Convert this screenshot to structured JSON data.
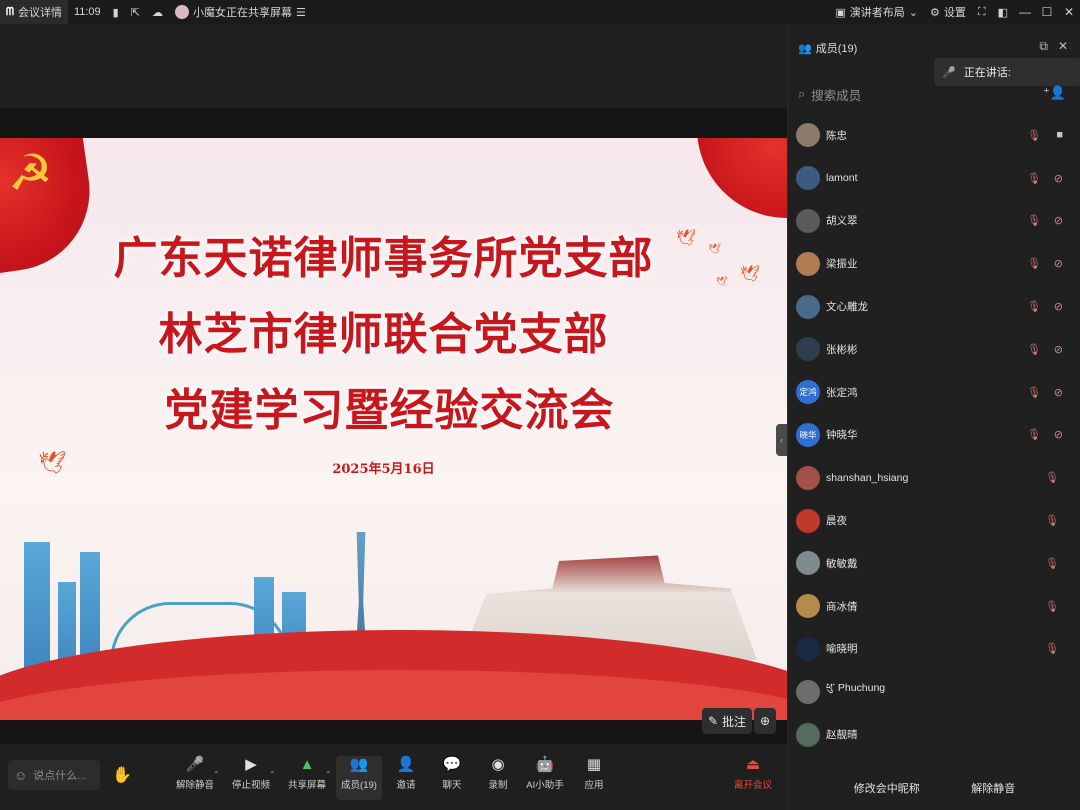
{
  "topbar": {
    "meeting_details": "会议详情",
    "time": "11:09",
    "sharing_notice": "小魔女正在共享屏幕",
    "presenter_layout": "演讲者布局",
    "settings": "设置"
  },
  "slide": {
    "title_line1": "广东天诺律师事务所党支部",
    "title_line2": "林芝市律师联合党支部",
    "title_line3": "党建学习暨经验交流会",
    "date": "2025年5月16日"
  },
  "stage_tools": {
    "annotate": "批注"
  },
  "toolbar": {
    "chat_placeholder": "说点什么...",
    "unmute": "解除静音",
    "stop_video": "停止视频",
    "share_screen": "共享屏幕",
    "members": "成员(19)",
    "invite": "邀请",
    "chat": "聊天",
    "record": "录制",
    "ai_assistant": "AI小助手",
    "apps": "应用",
    "leave": "离开会议"
  },
  "panel": {
    "title": "成员(19)",
    "speaking_label": "正在讲话:",
    "search_placeholder": "搜索成员",
    "footer_rename": "修改会中昵称",
    "footer_unmute": "解除静音",
    "members": [
      {
        "name": "陈忠",
        "avatar_text": "",
        "mic_muted": true,
        "cam": true,
        "cam_off": false
      },
      {
        "name": "lamont",
        "avatar_text": "",
        "mic_muted": true,
        "cam": true,
        "cam_off": true
      },
      {
        "name": "胡义翠",
        "avatar_text": "",
        "mic_muted": true,
        "cam": true,
        "cam_off": true
      },
      {
        "name": "梁振业",
        "avatar_text": "",
        "mic_muted": true,
        "cam": true,
        "cam_off": true
      },
      {
        "name": "文心雕龙",
        "avatar_text": "",
        "mic_muted": true,
        "cam": true,
        "cam_off": true
      },
      {
        "name": "张彬彬",
        "avatar_text": "",
        "mic_muted": true,
        "cam": true,
        "cam_off": true
      },
      {
        "name": "张定鸿",
        "avatar_text": "定鸿",
        "mic_muted": true,
        "cam": true,
        "cam_off": true
      },
      {
        "name": "钟晓华",
        "avatar_text": "晓华",
        "mic_muted": true,
        "cam": true,
        "cam_off": true
      },
      {
        "name": "shanshan_hsiang",
        "avatar_text": "",
        "mic_muted": true,
        "cam": false
      },
      {
        "name": "晨夜",
        "avatar_text": "",
        "mic_muted": true,
        "cam": false
      },
      {
        "name": "敏敏戴",
        "avatar_text": "",
        "mic_muted": true,
        "cam": false
      },
      {
        "name": "商冰倩",
        "avatar_text": "",
        "mic_muted": true,
        "cam": false
      },
      {
        "name": "喻晓明",
        "avatar_text": "",
        "mic_muted": true,
        "cam": false
      },
      {
        "name": "ཕུ་ Phuchung",
        "avatar_text": "",
        "mic_muted": false,
        "cam": false
      },
      {
        "name": "赵靓晴",
        "avatar_text": "",
        "mic_muted": false,
        "cam": false
      }
    ]
  },
  "colors": {
    "accent_red": "#e8473b",
    "title_red": "#c8171c",
    "panel_bg": "#202020",
    "avatar_blue": "#2f6fd1"
  }
}
